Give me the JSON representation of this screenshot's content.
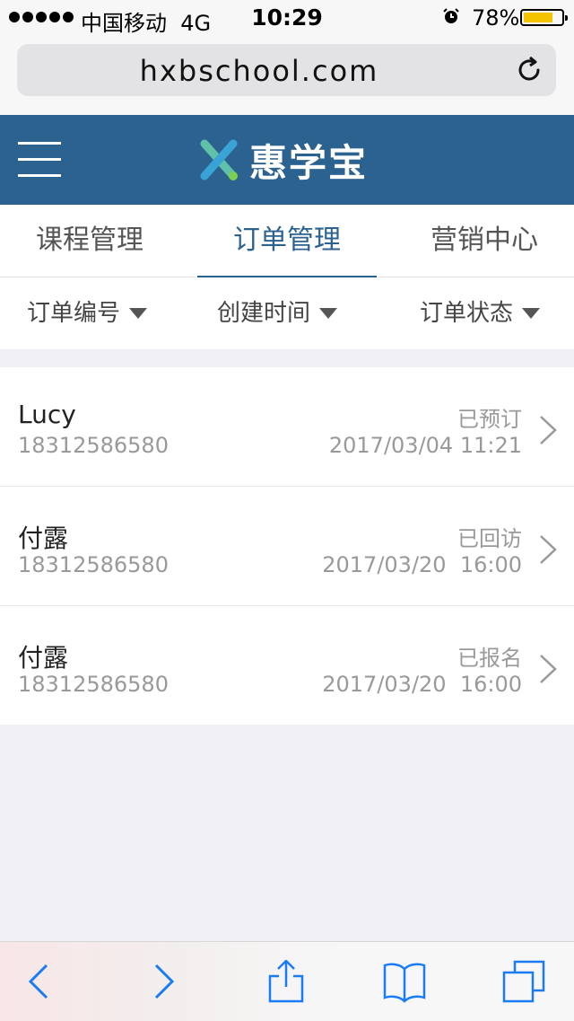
{
  "status_bar": {
    "carrier": "中国移动",
    "network": "4G",
    "time": "10:29",
    "battery_text": "78%",
    "battery_level": 0.78,
    "battery_color": "#f5c400"
  },
  "browser": {
    "url": "hxbschool.com",
    "reload_icon": "reload-icon"
  },
  "header": {
    "menu_icon": "hamburger-menu-icon",
    "brand_name": "惠学宝",
    "color": "#2b6290"
  },
  "tabs": [
    {
      "label": "课程管理",
      "active": false
    },
    {
      "label": "订单管理",
      "active": true
    },
    {
      "label": "营销中心",
      "active": false
    }
  ],
  "filters": [
    {
      "label": "订单编号"
    },
    {
      "label": "创建时间"
    },
    {
      "label": "订单状态"
    }
  ],
  "orders": [
    {
      "name": "Lucy",
      "phone": "18312586580",
      "status": "已预订",
      "time": "2017/03/04 11:21"
    },
    {
      "name": "付露",
      "phone": "18312586580",
      "status": "已回访",
      "time": "2017/03/20  16:00"
    },
    {
      "name": "付露",
      "phone": "18312586580",
      "status": "已报名",
      "time": "2017/03/20  16:00"
    }
  ],
  "toolbar": {
    "icons": [
      "back-icon",
      "forward-icon",
      "share-icon",
      "bookmarks-icon",
      "tabs-icon"
    ],
    "accent": "#1a7cf5"
  }
}
